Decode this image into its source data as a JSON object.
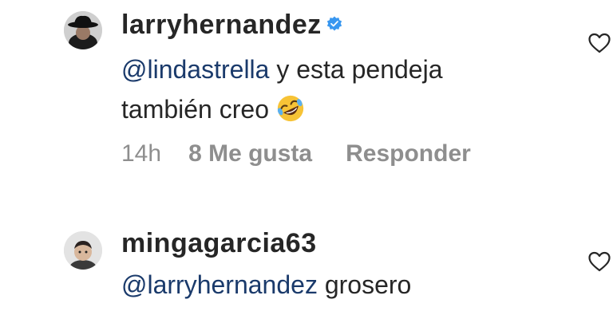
{
  "comments": [
    {
      "username": "larryhernandez",
      "verified": true,
      "mention": "@lindastrella",
      "text_line1": " y esta pendeja",
      "text_line2": "también creo",
      "emoji": "rolling-on-the-floor-laughing-emoji",
      "time": "14h",
      "likes": "8 Me gusta",
      "reply": "Responder"
    },
    {
      "username": "mingagarcia63",
      "verified": false,
      "mention": "@larryhernandez",
      "text": " grosero"
    }
  ],
  "colors": {
    "mention": "#1a3a6b",
    "meta": "#8e8e8e",
    "verified": "#3897f0"
  }
}
